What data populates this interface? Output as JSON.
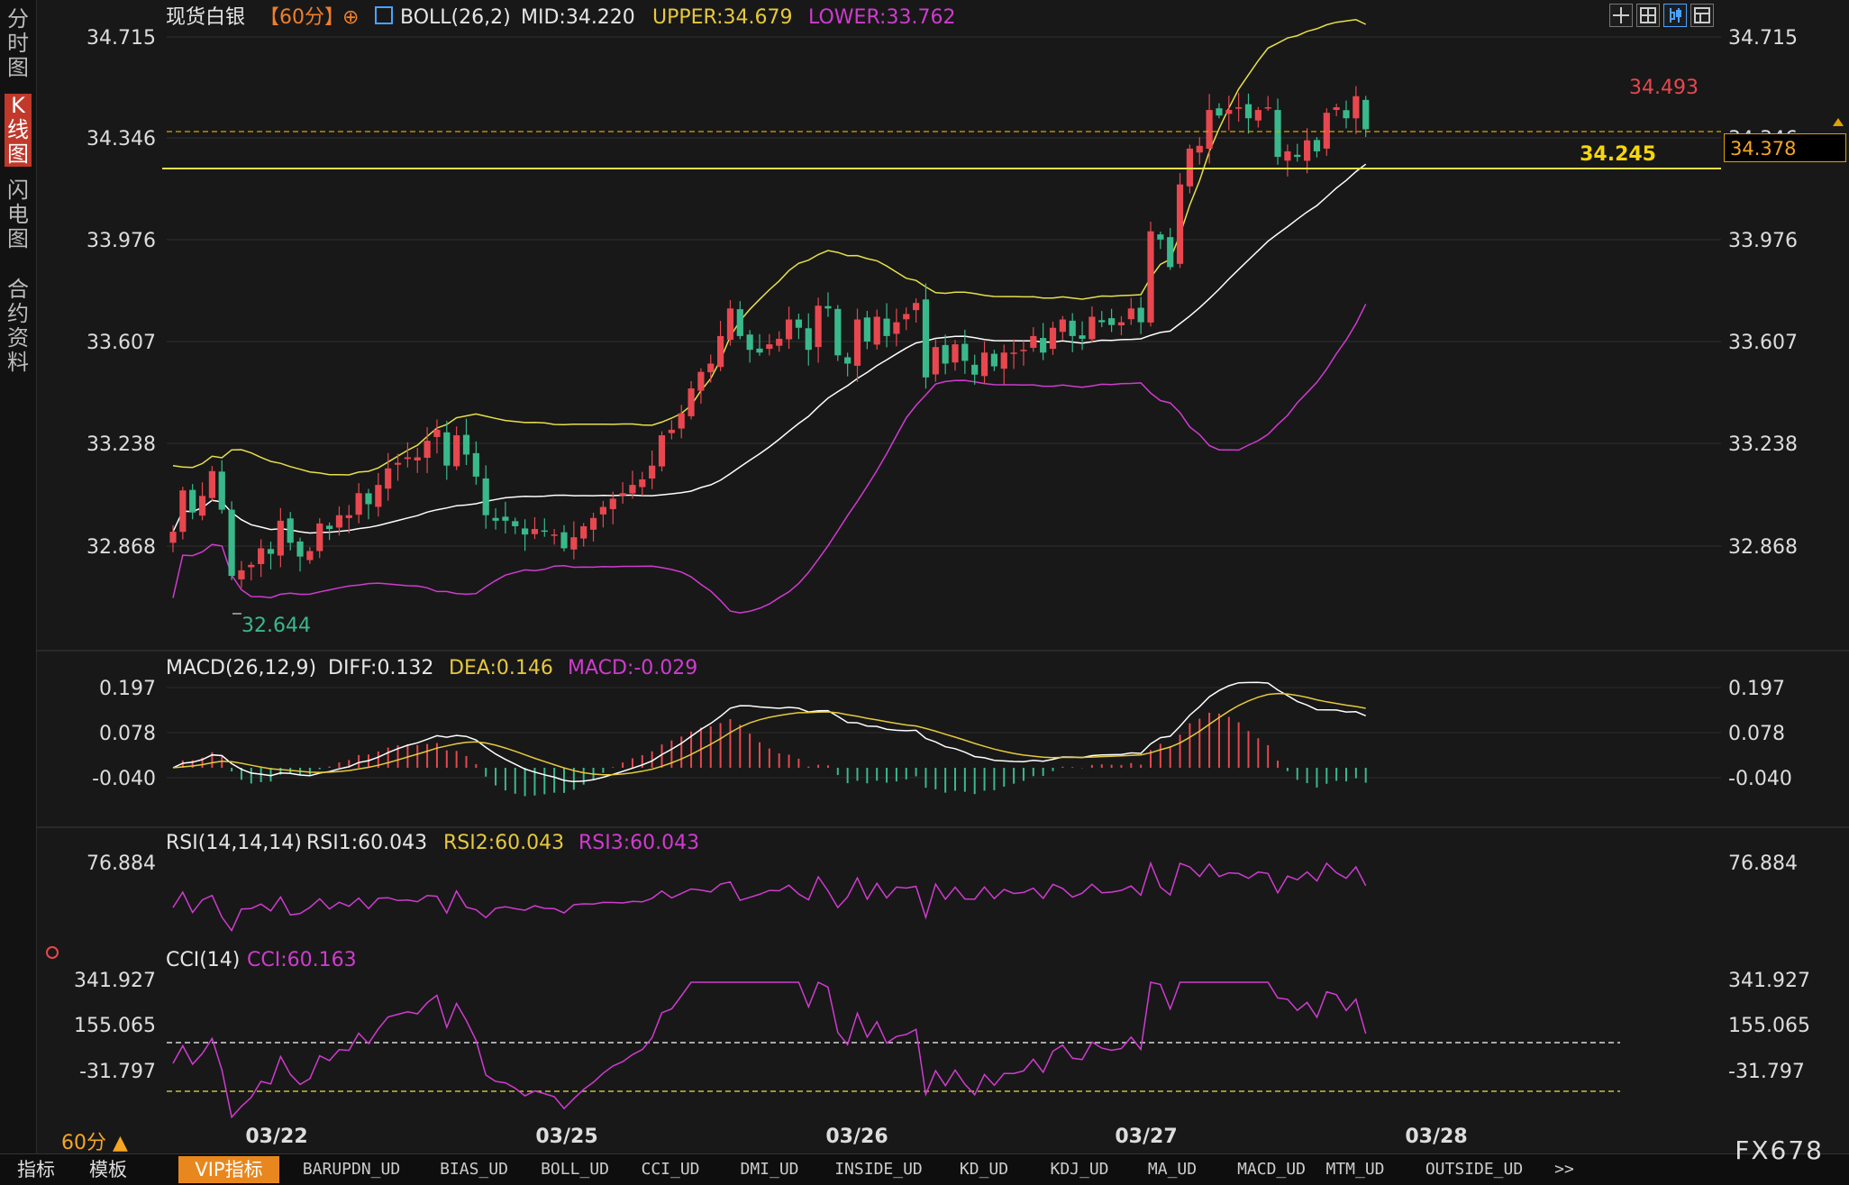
{
  "nav": [
    {
      "label": "分时图",
      "active": false
    },
    {
      "label": "K线图",
      "active": true
    },
    {
      "label": "闪电图",
      "active": false
    },
    {
      "label": "合约资料",
      "active": false
    }
  ],
  "header": {
    "instrument": "现货白银",
    "period_tag": "【60分】",
    "boll_label": "BOLL(26,2)",
    "mid": "MID:34.220",
    "upper": "UPPER:34.679",
    "lower": "LOWER:33.762"
  },
  "price_axis": [
    "34.715",
    "34.346",
    "33.976",
    "33.607",
    "33.238",
    "32.868"
  ],
  "annotations": {
    "high": "34.493",
    "low": "32.644",
    "hline_value": "34.245"
  },
  "current_price": "34.378",
  "macd_panel": {
    "title": "MACD(26,12,9)",
    "diff": "DIFF:0.132",
    "dea": "DEA:0.146",
    "macd": "MACD:-0.029",
    "axis": [
      "0.197",
      "0.078",
      "-0.040"
    ]
  },
  "rsi_panel": {
    "title": "RSI(14,14,14)",
    "rsi1": "RSI1:60.043",
    "rsi2": "RSI2:60.043",
    "rsi3": "RSI3:60.043",
    "axis": [
      "76.884"
    ]
  },
  "cci_panel": {
    "title": "CCI(14)",
    "cci": "CCI:60.163",
    "axis": [
      "341.927",
      "155.065",
      "-31.797"
    ]
  },
  "dates": [
    "03/22",
    "03/25",
    "03/26",
    "03/27",
    "03/28"
  ],
  "period_selector": "60分 ▲",
  "bottom_tabs": [
    "指标",
    "模板",
    "VIP指标",
    "BARUPDN_UD",
    "BIAS_UD",
    "BOLL_UD",
    "CCI_UD",
    "DMI_UD",
    "INSIDE_UD",
    "KD_UD",
    "KDJ_UD",
    "MA_UD",
    "MACD_UD",
    "MTM_UD",
    "OUTSIDE_UD",
    ">>"
  ],
  "brand": "FX678",
  "colors": {
    "up": "#e8474f",
    "down": "#39b98b",
    "upper": "#e6e04a",
    "mid": "#ffffff",
    "lower": "#d03bd0",
    "accent": "#f5a623"
  },
  "chart_data": {
    "type": "candlestick",
    "closes": [
      32.92,
      33.07,
      32.99,
      33.05,
      33.14,
      33.0,
      32.76,
      32.78,
      32.8,
      32.86,
      32.84,
      32.96,
      32.88,
      32.83,
      32.85,
      32.95,
      32.93,
      32.98,
      32.98,
      33.06,
      33.02,
      33.09,
      33.15,
      33.17,
      33.19,
      33.19,
      33.25,
      33.29,
      33.16,
      33.27,
      33.2,
      33.12,
      32.98,
      32.96,
      32.96,
      32.94,
      32.91,
      32.93,
      32.92,
      32.91,
      32.86,
      32.9,
      32.94,
      32.97,
      33.01,
      33.04,
      33.06,
      33.09,
      33.11,
      33.16,
      33.27,
      33.29,
      33.35,
      33.44,
      33.5,
      33.53,
      33.63,
      33.73,
      33.63,
      33.58,
      33.57,
      33.6,
      33.62,
      33.69,
      33.66,
      33.58,
      33.74,
      33.73,
      33.56,
      33.53,
      33.69,
      33.61,
      33.7,
      33.63,
      33.68,
      33.71,
      33.75,
      33.48,
      33.59,
      33.53,
      33.6,
      33.54,
      33.49,
      33.57,
      33.52,
      33.57,
      33.57,
      33.58,
      33.63,
      33.57,
      33.66,
      33.69,
      33.63,
      33.62,
      33.7,
      33.68,
      33.67,
      33.68,
      33.73,
      33.68,
      34.01,
      33.98,
      33.88,
      34.18,
      34.31,
      34.32,
      34.45,
      34.43,
      34.45,
      34.46,
      34.42,
      34.45,
      34.46,
      34.28,
      34.3,
      34.28,
      34.34,
      34.3,
      34.44,
      34.46,
      34.42,
      34.5,
      34.38
    ],
    "boll": {
      "mid": 34.22,
      "upper": 34.679,
      "lower": 33.762
    },
    "macd": {
      "diff": 0.132,
      "dea": 0.146,
      "macd": -0.029
    },
    "rsi": {
      "rsi1": 60.043,
      "rsi2": 60.043,
      "rsi3": 60.043
    },
    "cci": 60.163,
    "high_label": 34.493,
    "low_label": 32.644,
    "current": 34.378,
    "price_ticks": [
      34.715,
      34.346,
      33.976,
      33.607,
      33.238,
      32.868
    ]
  }
}
